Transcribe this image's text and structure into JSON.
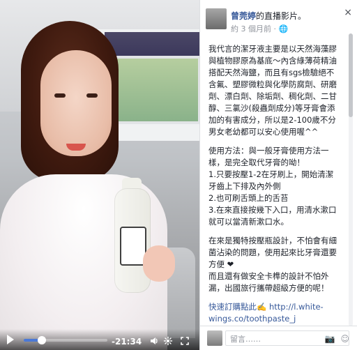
{
  "video": {
    "time_remaining": "-21:34",
    "progress": 0.22,
    "controls": {
      "play_icon": "play-icon",
      "volume_icon": "volume-icon",
      "settings_icon": "gear-icon",
      "fullscreen_icon": "fullscreen-icon"
    }
  },
  "panel": {
    "author": "曾莞婷",
    "suffix": "的直播影片。",
    "meta": "約 3 個月前 · ",
    "post_paragraphs": [
      "我代言的潔牙液主要是以天然海藻膠與植物膠原為基底～內含綠薄荷精油搭配天然海鹽，而且有sgs檢驗絕不含氟、塑膠微粒與化學防腐劑、研磨劑、漂白劑、除垢劑、稠化劑、二甘醇、三氯沙(殺蟲劑成分)等牙膏會添加的有害成分，所以是2-100歲不分男女老幼都可以安心使用喔^^",
      "使用方法：與一般牙膏使用方法一樣，是完全取代牙膏的呦！\n1.只要按壓1-2在牙刷上，開始清潔牙齒上下排及內外側\n2.也可刷舌頭上的舌苔\n3.在來直接按幾下入口，用清水漱口就可以當清新漱口水。",
      "在來是獨特按壓瓶設計，不怕會有細菌沾染的問題，使用起來比牙膏還要方便 ❤\n而且還有做安全卡榫的設計不怕外漏，出國旅行攜帶超級方便的呢！",
      "快速訂購點此✍️ http://l.white-wings.co/toothpaste_j\n白色翅膀White Wings"
    ],
    "comment_placeholder": "留言……",
    "accent": "#365899",
    "muted": "#90949c",
    "heart": "#f04f8d"
  }
}
